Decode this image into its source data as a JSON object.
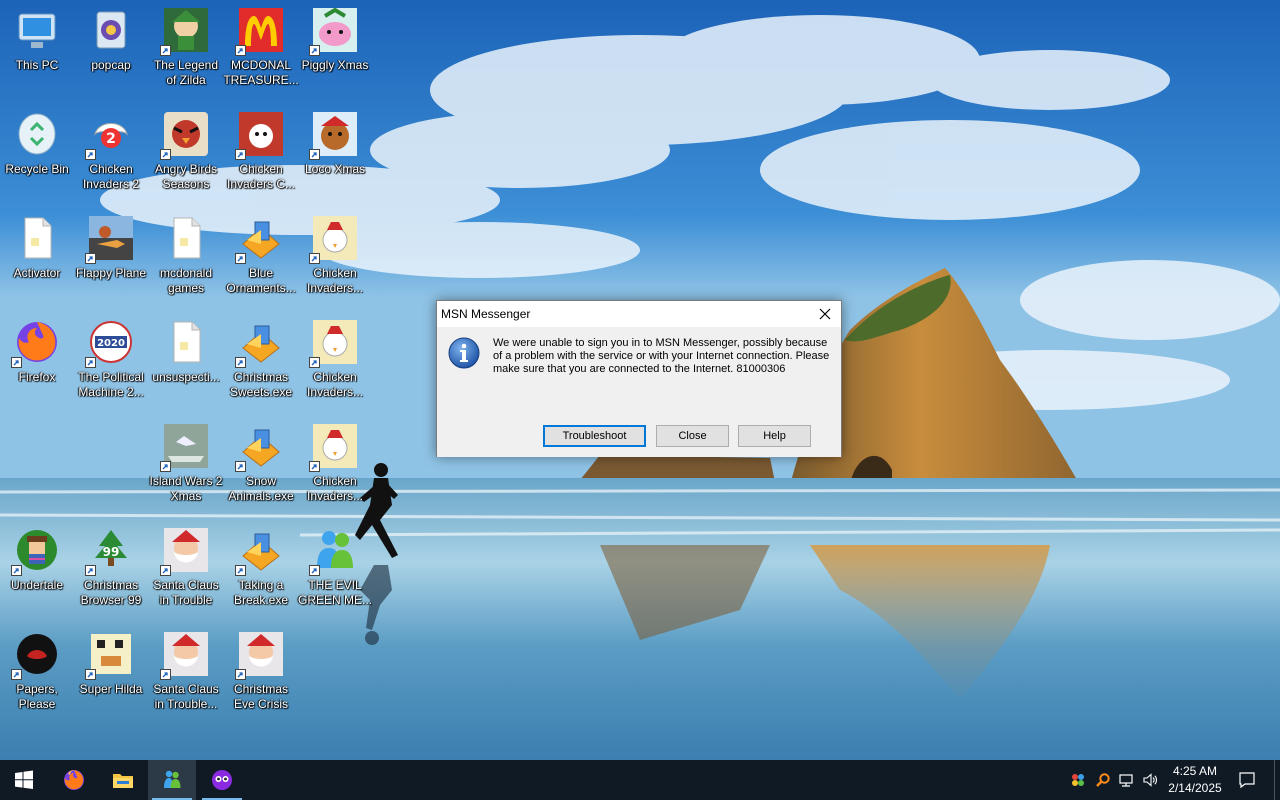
{
  "desktop": {
    "icons": [
      {
        "label": "This PC",
        "icon": "this-pc-icon",
        "shortcut": false
      },
      {
        "label": "Recycle Bin",
        "icon": "recycle-bin-icon",
        "shortcut": false
      },
      {
        "label": "Activator",
        "icon": "document-icon",
        "shortcut": false
      },
      {
        "label": "Firefox",
        "icon": "firefox-icon",
        "shortcut": true
      },
      {
        "label": "Undertale",
        "icon": "undertale-icon",
        "shortcut": true
      },
      {
        "label": "Papers,\nPlease",
        "icon": "papers-please-icon",
        "shortcut": true
      },
      {
        "label": "popcap",
        "icon": "popcap-icon",
        "shortcut": false
      },
      {
        "label": "Chicken\nInvaders 2",
        "icon": "chicken-invaders-2-icon",
        "shortcut": true
      },
      {
        "label": "Flappy Plane",
        "icon": "flappy-plane-icon",
        "shortcut": true
      },
      {
        "label": "The Political\nMachine 2...",
        "icon": "political-machine-icon",
        "shortcut": true
      },
      {
        "label": "Christmas\nBrowser 99",
        "icon": "christmas-tree-icon",
        "shortcut": true
      },
      {
        "label": "Super Hilda",
        "icon": "super-hilda-icon",
        "shortcut": true
      },
      {
        "label": "The Legend\nof Zilda",
        "icon": "legend-of-zilda-icon",
        "shortcut": true
      },
      {
        "label": "Angry Birds\nSeasons",
        "icon": "angry-birds-icon",
        "shortcut": true
      },
      {
        "label": "mcdonald\ngames",
        "icon": "document-icon",
        "shortcut": false
      },
      {
        "label": "unsuspecti...",
        "icon": "document-icon",
        "shortcut": false
      },
      {
        "label": "Island Wars 2\nXmas",
        "icon": "island-wars-icon",
        "shortcut": true
      },
      {
        "label": "Santa Claus\nin Trouble",
        "icon": "santa-claus-icon",
        "shortcut": true
      },
      {
        "label": "Santa Claus\nin Trouble...",
        "icon": "santa-claus-icon",
        "shortcut": true
      },
      {
        "label": "MCDONAL\nTREASURE...",
        "icon": "mcdonalds-icon",
        "shortcut": true
      },
      {
        "label": "Chicken\nInvaders C...",
        "icon": "chicken-invaders-c-icon",
        "shortcut": true
      },
      {
        "label": "Blue\nOrnaments...",
        "icon": "installer-icon",
        "shortcut": true
      },
      {
        "label": "Christmas\nSweets.exe",
        "icon": "installer-icon",
        "shortcut": true
      },
      {
        "label": "Snow\nAnimals.exe",
        "icon": "installer-icon",
        "shortcut": true
      },
      {
        "label": "Taking a\nBreak.exe",
        "icon": "installer-icon",
        "shortcut": true
      },
      {
        "label": "Christmas\nEve Crisis",
        "icon": "santa-claus-icon",
        "shortcut": true
      },
      {
        "label": "Piggly Xmas",
        "icon": "piggly-xmas-icon",
        "shortcut": true
      },
      {
        "label": "Loco Xmas",
        "icon": "loco-xmas-icon",
        "shortcut": true
      },
      {
        "label": "Chicken\nInvaders...",
        "icon": "chicken-invaders-icon",
        "shortcut": true
      },
      {
        "label": "Chicken\nInvaders...",
        "icon": "chicken-invaders-icon",
        "shortcut": true
      },
      {
        "label": "Chicken\nInvaders...",
        "icon": "chicken-invaders-icon",
        "shortcut": true
      },
      {
        "label": "THE EVIL\nGREEN ME...",
        "icon": "msn-messenger-icon",
        "shortcut": true
      }
    ]
  },
  "dialog": {
    "title": "MSN Messenger",
    "message": "We were unable to sign you in to MSN Messenger, possibly because of a problem with the service or with your Internet connection. Please make sure that you are connected to the Internet.  81000306",
    "buttons": {
      "troubleshoot": "Troubleshoot",
      "close": "Close",
      "help": "Help"
    },
    "icon": "info-icon"
  },
  "taskbar": {
    "pinned": [
      {
        "name": "start-button",
        "icon": "windows-logo-icon"
      },
      {
        "name": "firefox",
        "icon": "firefox-icon"
      },
      {
        "name": "file-explorer",
        "icon": "folder-icon"
      },
      {
        "name": "msn-messenger",
        "icon": "msn-messenger-icon",
        "active": true
      },
      {
        "name": "app-purple",
        "icon": "purple-app-icon"
      }
    ],
    "clock": {
      "time": "4:25 AM",
      "date": "2/14/2025"
    },
    "colors": {
      "background": "#0f1a24",
      "accent": "#76b9ed"
    }
  }
}
